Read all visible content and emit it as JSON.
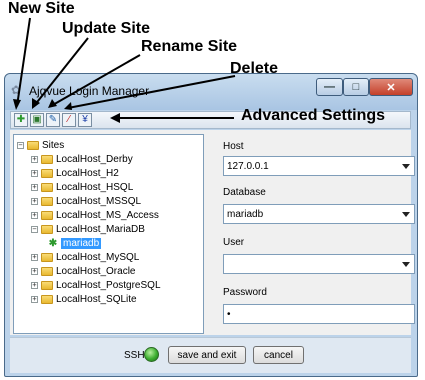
{
  "callouts": {
    "new_site": "New Site",
    "update_site": "Update Site",
    "rename_site": "Rename Site",
    "delete": "Delete",
    "advanced_settings": "Advanced Settings"
  },
  "window": {
    "title": "Ajqvue Login Manager",
    "controls": {
      "minimize": "—",
      "maximize": "□",
      "close": "✕"
    }
  },
  "toolbar": {
    "buttons": [
      {
        "name": "new-site-button",
        "icon": "new-site-icon"
      },
      {
        "name": "update-site-button",
        "icon": "update-site-icon"
      },
      {
        "name": "rename-site-button",
        "icon": "rename-site-icon"
      },
      {
        "name": "delete-button",
        "icon": "delete-icon"
      },
      {
        "name": "advanced-settings-button",
        "icon": "advanced-settings-icon"
      }
    ]
  },
  "tree": {
    "root": "Sites",
    "items": [
      "LocalHost_Derby",
      "LocalHost_H2",
      "LocalHost_HSQL",
      "LocalHost_MSSQL",
      "LocalHost_MS_Access",
      "LocalHost_MariaDB",
      "mariadb",
      "LocalHost_MySQL",
      "LocalHost_Oracle",
      "LocalHost_PostgreSQL",
      "LocalHost_SQLite"
    ]
  },
  "form": {
    "host_label": "Host",
    "host_value": "127.0.0.1",
    "database_label": "Database",
    "database_value": "mariadb",
    "user_label": "User",
    "user_value": "",
    "password_label": "Password",
    "password_value": "•"
  },
  "bottom": {
    "ssh_label": "SSH",
    "save_label": "save and exit",
    "cancel_label": "cancel"
  },
  "colors": {
    "selection": "#3399ff",
    "ssh_status": "#3cae30"
  }
}
